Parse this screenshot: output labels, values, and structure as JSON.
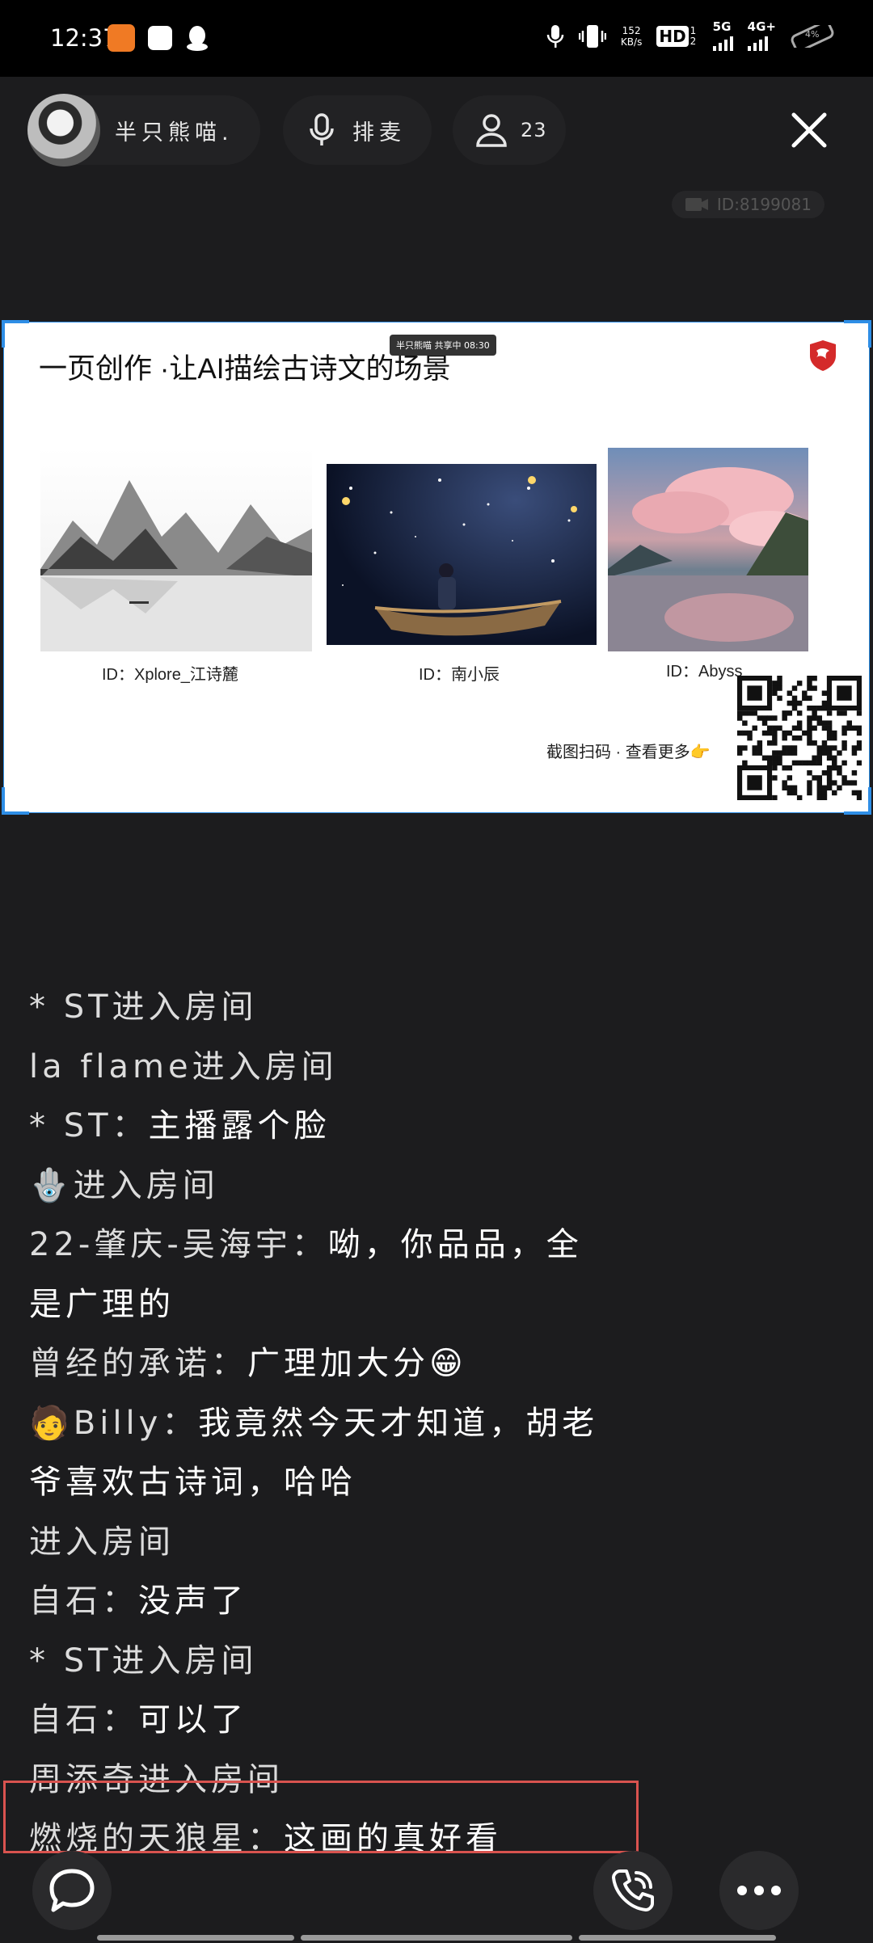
{
  "status_bar": {
    "time": "12:37",
    "net_speed_value": "152",
    "net_speed_unit": "KB/s",
    "hd": "HD",
    "sim_num": "12",
    "net_5g": "5G",
    "net_4g": "4G+",
    "battery": "4%"
  },
  "room": {
    "host_name": "半只熊喵.",
    "queue_label": "排麦",
    "member_count": "23",
    "room_id": "ID:8199081"
  },
  "shared_screen": {
    "title": "一页创作 ·让AI描绘古诗文的场景",
    "share_badge": "半只熊喵 共享中 08:30",
    "artworks": [
      {
        "caption": "ID：Xplore_江诗麓"
      },
      {
        "caption": "ID：南小辰"
      },
      {
        "caption": "ID：Abyss"
      }
    ],
    "scan_hint": "截图扫码 · 查看更多👉"
  },
  "chat": [
    {
      "who": "* ST进入房间",
      "text": ""
    },
    {
      "who": "la flame进入房间",
      "text": ""
    },
    {
      "who": "* ST：",
      "text": "主播露个脸"
    },
    {
      "who": "🪬进入房间",
      "text": ""
    },
    {
      "who": "22-肇庆-吴海宇：",
      "text": "呦，你品品，全"
    },
    {
      "who": "",
      "text": "是广理的"
    },
    {
      "who": "曾经的承诺：",
      "text": "广理加大分😁"
    },
    {
      "who": "🧑Billy：",
      "text": "我竟然今天才知道，胡老"
    },
    {
      "who": "",
      "text": "爷喜欢古诗词，哈哈"
    },
    {
      "who": "进入房间",
      "text": ""
    },
    {
      "who": "自石：",
      "text": "没声了"
    },
    {
      "who": "* ST进入房间",
      "text": ""
    },
    {
      "who": "自石：",
      "text": "可以了"
    },
    {
      "who": "周添奇进入房间",
      "text": ""
    },
    {
      "who": "燃烧的天狼星：",
      "text": "这画的真好看"
    }
  ],
  "colors": {
    "background": "#1c1c1e",
    "highlight_border": "#d9534f",
    "screen_frame": "#2e8ee6"
  }
}
